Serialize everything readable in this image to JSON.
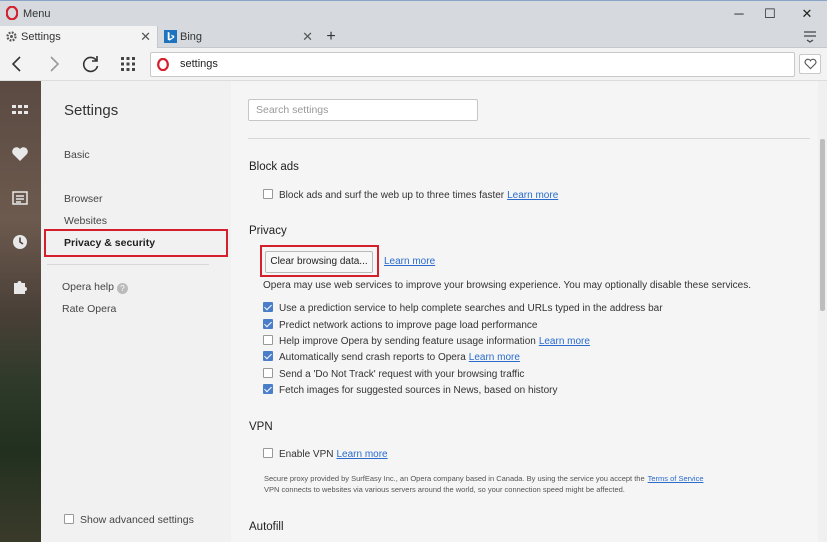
{
  "window": {
    "menu_label": "Menu",
    "minimize_label": "─",
    "maximize_label": "☐",
    "close_label": "✕"
  },
  "tabs": [
    {
      "label": "Settings",
      "icon": "gear-icon",
      "close": "✕",
      "active": true
    },
    {
      "label": "Bing",
      "icon": "bing-icon",
      "close": "✕",
      "active": false
    }
  ],
  "new_tab_label": "+",
  "address_bar": {
    "url": "settings"
  },
  "settings_nav": {
    "title": "Settings",
    "items": [
      "Basic",
      "Browser",
      "Websites",
      "Privacy & security"
    ],
    "selected": "Privacy & security",
    "help_label": "Opera help",
    "help_icon": "?",
    "rate_label": "Rate Opera",
    "advanced_label": "Show advanced settings"
  },
  "search": {
    "placeholder": "Search settings"
  },
  "block_ads": {
    "title": "Block ads",
    "option": "Block ads and surf the web up to three times faster",
    "link": "Learn more",
    "checked": false
  },
  "privacy": {
    "title": "Privacy",
    "clear_button": "Clear browsing data...",
    "link": "Learn more",
    "description": "Opera may use web services to improve your browsing experience. You may optionally disable these services.",
    "options": [
      {
        "label": "Use a prediction service to help complete searches and URLs typed in the address bar",
        "checked": true,
        "link": ""
      },
      {
        "label": "Predict network actions to improve page load performance",
        "checked": true,
        "link": ""
      },
      {
        "label": "Help improve Opera by sending feature usage information",
        "checked": false,
        "link": "Learn more"
      },
      {
        "label": "Automatically send crash reports to Opera",
        "checked": true,
        "link": "Learn more"
      },
      {
        "label": "Send a 'Do Not Track' request with your browsing traffic",
        "checked": false,
        "link": ""
      },
      {
        "label": "Fetch images for suggested sources in News, based on history",
        "checked": true,
        "link": ""
      }
    ]
  },
  "vpn": {
    "title": "VPN",
    "option": "Enable VPN",
    "link": "Learn more",
    "checked": false,
    "note_line1": "Secure proxy provided by SurfEasy Inc., an Opera company based in Canada. By using the service you accept the",
    "note_link": "Terms of Service",
    "note_line2": "VPN connects to websites via various servers around the world, so your connection speed might be affected."
  },
  "autofill": {
    "title": "Autofill"
  },
  "colors": {
    "opera_red": "#d41f2c",
    "accent_blue": "#4a7ec8",
    "link_blue": "#2a6bcc"
  }
}
